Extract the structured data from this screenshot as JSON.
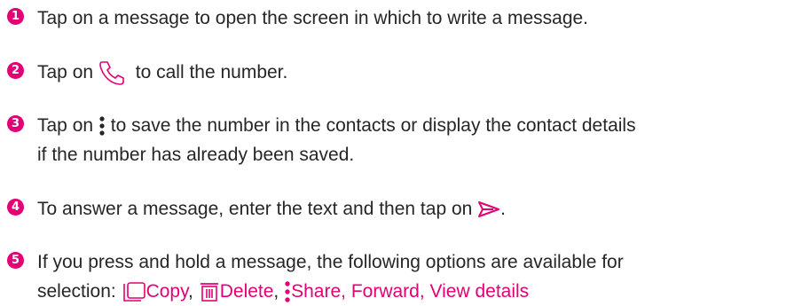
{
  "steps": [
    {
      "number": "1",
      "text": "Tap on a message to open the screen in which to write a message."
    },
    {
      "number": "2",
      "before": "Tap on",
      "after": "to call the number.",
      "icon": "phone-icon"
    },
    {
      "number": "3",
      "before": "Tap on",
      "line1": "to save the number in the contacts or display the contact details",
      "line2": "if the number has already been saved.",
      "icon": "more-vertical-icon"
    },
    {
      "number": "4",
      "before": "To answer a message, enter the text and then tap on",
      "after": ".",
      "icon": "send-icon"
    },
    {
      "number": "5",
      "line1": "If you press and hold a message, the following options are available for",
      "line2_prefix": "selection:",
      "copy": "Copy",
      "sep1": ",",
      "delete": "Delete",
      "sep2": ",",
      "share": "Share, Forward, View details",
      "icons": [
        "copy-icon",
        "delete-icon",
        "more-vertical-icon"
      ]
    }
  ],
  "colors": {
    "accent": "#e20074",
    "text": "#262626"
  }
}
